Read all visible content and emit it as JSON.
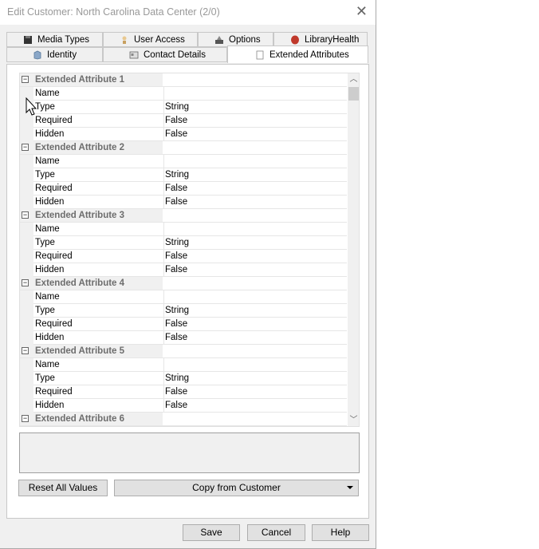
{
  "window": {
    "title": "Edit Customer: North Carolina Data Center (2/0)",
    "close_glyph": "✕"
  },
  "tabs": {
    "row1": [
      {
        "label": "Media Types",
        "icon": "media-types-icon"
      },
      {
        "label": "User Access",
        "icon": "user-access-icon"
      },
      {
        "label": "Options",
        "icon": "options-icon"
      },
      {
        "label": "LibraryHealth",
        "icon": "library-health-icon"
      }
    ],
    "row2": [
      {
        "label": "Identity",
        "icon": "identity-icon"
      },
      {
        "label": "Contact Details",
        "icon": "contact-details-icon"
      },
      {
        "label": "Extended Attributes",
        "icon": "extended-attributes-icon"
      }
    ],
    "active": "Extended Attributes"
  },
  "grid": {
    "groups": [
      {
        "title": "Extended Attribute 1",
        "rows": [
          {
            "name": "Name",
            "value": ""
          },
          {
            "name": "Type",
            "value": "String"
          },
          {
            "name": "Required",
            "value": "False"
          },
          {
            "name": "Hidden",
            "value": "False"
          }
        ]
      },
      {
        "title": "Extended Attribute 2",
        "rows": [
          {
            "name": "Name",
            "value": ""
          },
          {
            "name": "Type",
            "value": "String"
          },
          {
            "name": "Required",
            "value": "False"
          },
          {
            "name": "Hidden",
            "value": "False"
          }
        ]
      },
      {
        "title": "Extended Attribute 3",
        "rows": [
          {
            "name": "Name",
            "value": ""
          },
          {
            "name": "Type",
            "value": "String"
          },
          {
            "name": "Required",
            "value": "False"
          },
          {
            "name": "Hidden",
            "value": "False"
          }
        ]
      },
      {
        "title": "Extended Attribute 4",
        "rows": [
          {
            "name": "Name",
            "value": ""
          },
          {
            "name": "Type",
            "value": "String"
          },
          {
            "name": "Required",
            "value": "False"
          },
          {
            "name": "Hidden",
            "value": "False"
          }
        ]
      },
      {
        "title": "Extended Attribute 5",
        "rows": [
          {
            "name": "Name",
            "value": ""
          },
          {
            "name": "Type",
            "value": "String"
          },
          {
            "name": "Required",
            "value": "False"
          },
          {
            "name": "Hidden",
            "value": "False"
          }
        ]
      },
      {
        "title": "Extended Attribute 6",
        "rows": []
      }
    ],
    "collapse_glyph": "−"
  },
  "buttons": {
    "reset": "Reset All Values",
    "copy": "Copy from Customer",
    "save": "Save",
    "cancel": "Cancel",
    "help": "Help"
  }
}
